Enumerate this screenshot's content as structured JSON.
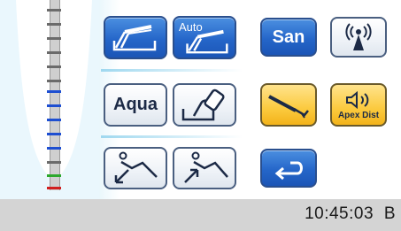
{
  "buttons": {
    "instrument_1": {
      "icon": "handpiece-tray-icon"
    },
    "instrument_auto": {
      "label": "Auto",
      "icon": "handpiece-tray-icon"
    },
    "san": {
      "label": "San"
    },
    "wireless": {
      "icon": "wireless-signal-icon"
    },
    "aqua": {
      "label": "Aqua"
    },
    "cup_fill": {
      "icon": "cup-fill-icon"
    },
    "endo_motor": {
      "icon": "endo-handpiece-icon"
    },
    "apex_dist": {
      "label": "Apex Dist",
      "icon": "speaker-icon"
    },
    "chair_down": {
      "icon": "chair-recline-down-icon"
    },
    "chair_up": {
      "icon": "chair-recline-up-icon"
    },
    "return": {
      "icon": "return-arrow-icon"
    }
  },
  "status_bar": {
    "time": "10:45:03",
    "suffix": "B"
  },
  "colors": {
    "accent_blue": "#2566c9",
    "accent_orange": "#f3b31a",
    "scale_blue": "#1e4fd1",
    "scale_green": "#2ca82c",
    "scale_red": "#d11f1f"
  }
}
